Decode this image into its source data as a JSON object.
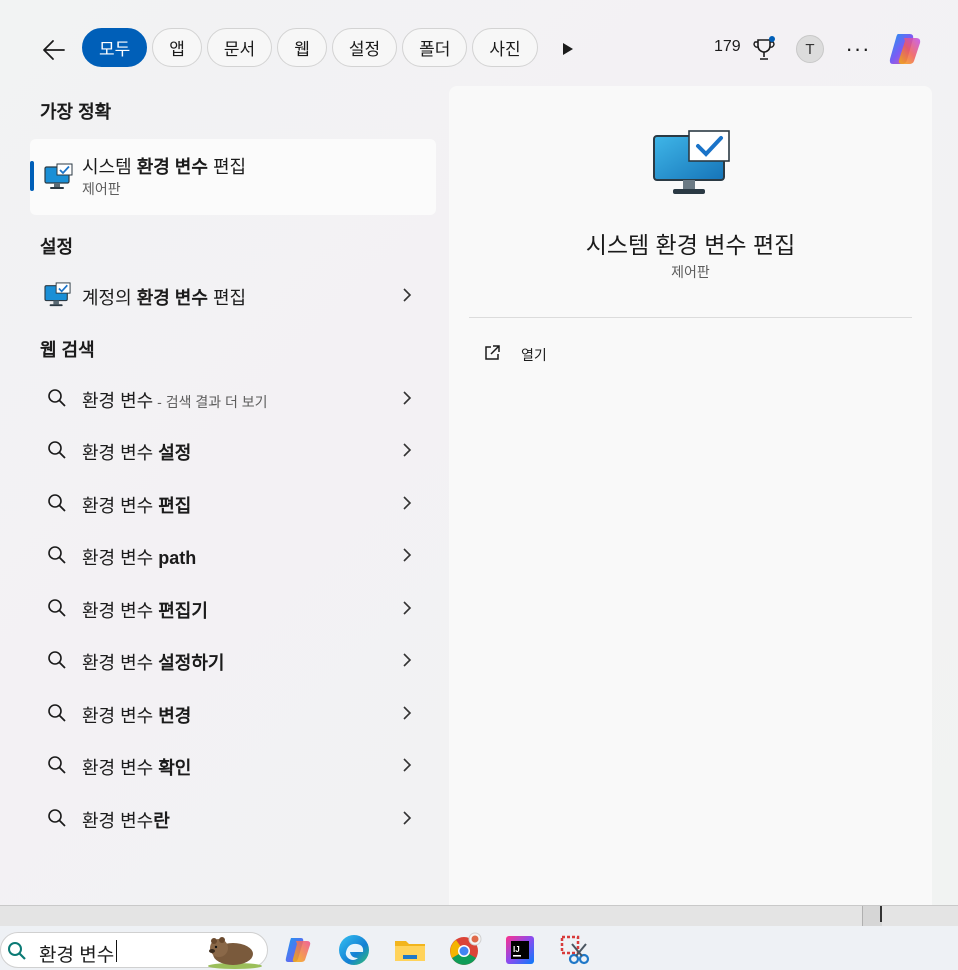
{
  "top_bar": {
    "tabs": [
      "모두",
      "앱",
      "문서",
      "웹",
      "설정",
      "폴더",
      "사진"
    ],
    "active_tab": 0,
    "points": "179",
    "avatar_initial": "T",
    "more_label": "···"
  },
  "best_match": {
    "section_title": "가장 정확",
    "title_plain_1": "시스템 ",
    "title_bold": "환경 변수",
    "title_plain_2": " 편집",
    "subtitle": "제어판"
  },
  "settings": {
    "section_title": "설정",
    "item_plain_1": "계정의 ",
    "item_bold": "환경 변수",
    "item_plain_2": " 편집"
  },
  "web": {
    "section_title": "웹 검색",
    "first": {
      "query": "환경 변수",
      "hint": " - 검색 결과 더 보기"
    },
    "suggestions": [
      {
        "plain": "환경 변수 ",
        "bold": "설정"
      },
      {
        "plain": "환경 변수 ",
        "bold": "편집"
      },
      {
        "plain": "환경 변수 ",
        "bold": "path"
      },
      {
        "plain": "환경 변수 ",
        "bold": "편집기"
      },
      {
        "plain": "환경 변수 ",
        "bold": "설정하기"
      },
      {
        "plain": "환경 변수 ",
        "bold": "변경"
      },
      {
        "plain": "환경 변수 ",
        "bold": "확인"
      },
      {
        "plain": "환경 변수",
        "bold": "란"
      }
    ]
  },
  "preview": {
    "title": "시스템 환경 변수 편집",
    "subtitle": "제어판",
    "actions": [
      "열기"
    ]
  },
  "taskbar": {
    "search_value": "환경 변수",
    "apps": [
      "copilot",
      "edge",
      "file-explorer",
      "chrome",
      "intellij-idea",
      "snipping-tool"
    ]
  },
  "colors": {
    "accent": "#005fb8"
  }
}
